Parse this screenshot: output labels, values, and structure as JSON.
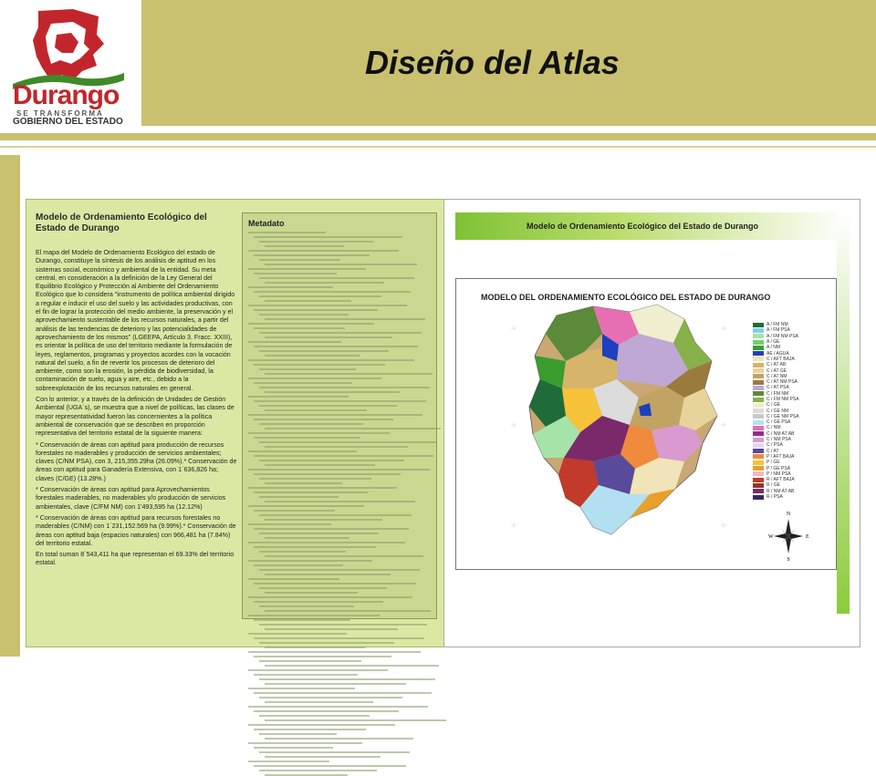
{
  "slide": {
    "title": "Diseño del Atlas"
  },
  "logo": {
    "name": "Durango",
    "tagline": "SE TRANSFORMA",
    "gov": "GOBIERNO DEL ESTADO"
  },
  "left_panel": {
    "heading": "Modelo de Ordenamiento Ecológico del Estado de Durango",
    "paragraphs": [
      "El mapa del Modelo de Ordenamiento Ecológico del estado de Durango, constituye la síntesis de los análisis de aptitud en los sistemas social, económico y ambiental de la entidad. Su meta central, en consideración a la definición de la Ley General del Equilibrio Ecológico y Protección al Ambiente del Ordenamiento Ecológico que lo considera \"instrumento de política ambiental dirigido a regular e inducir el uso del suelo y las actividades productivas, con el fin de lograr la protección del medio ambiente, la preservación y el aprovechamiento sustentable de los recursos naturales, a partir del análisis de las tendencias de deterioro y las potencialidades de aprovechamiento de los mismos\" (LGEEPA, Artículo 3. Fracc. XXIII), es orientar la política de uso del territorio mediante la formulación de leyes, reglamentos, programas y proyectos acordes con la vocación natural del suelo, a fin de revertir los procesos de deterioro del ambiente, como son la erosión, la pérdida de biodiversidad, la contaminación de suelo, agua y aire, etc., debido a la sobreexplotación de los recursos naturales en general.",
      "Con lo anterior, y a través de la definición de Unidades de Gestión Ambiental (UGA´s), se muestra que a nivel de políticas, las clases de mayor representatividad fueron las concernientes a la política ambiental de conservación que se describen en proporción representativa del territorio estatal de la siguiente manera:",
      "*        Conservación de áreas con aptitud para producción de recursos forestales no maderables y producción de servicios ambientales; claves (C/NM PSA), con 3, 215,355.29ha (26.09%).*      Conservación de áreas con aptitud para Ganadería Extensiva, con 1´636,826 ha; claves (C/GE) (13.28%.)",
      "*        Conservación de áreas con aptitud para Aprovechamientos forestales maderables, no maderables y/o producción de servicios ambientales, clave (C/FM NM) con 1'493,595 ha (12.12%)",
      "*        Conservación de áreas con aptitud para recursos forestales no maderables (C/NM) con 1´231,152.569 ha (9.99%).*      Conservación de áreas con aptitud baja (espacios naturales) con 966,481 ha (7.84%) del territorio estatal.",
      "En total suman 8´543,411 ha que representan el 69.33% del territorio estatal."
    ],
    "metadata_heading": "Metadato"
  },
  "right_panel": {
    "header": "Modelo de Ordenamiento Ecológico del Estado de Durango",
    "map_title": "MODELO DEL ORDENAMIENTO ECOLÓGICO DEL ESTADO DE DURANGO",
    "compass": {
      "n": "N",
      "s": "S",
      "e": "E",
      "w": "W"
    },
    "legend": [
      {
        "label": "A / FM NM",
        "color": "#1f6b3a"
      },
      {
        "label": "A / FM PSA",
        "color": "#7fd0e6"
      },
      {
        "label": "A / FM NM PSA",
        "color": "#a6e3a8"
      },
      {
        "label": "A / GE",
        "color": "#6fd06f"
      },
      {
        "label": "A / NM",
        "color": "#3a9c2e"
      },
      {
        "label": "AE / AGUA",
        "color": "#1e3fbf"
      },
      {
        "label": "C / AFT BAJA",
        "color": "#f0e4b8"
      },
      {
        "label": "C / AT AB",
        "color": "#d6b46a"
      },
      {
        "label": "C / AT GE",
        "color": "#e7d49a"
      },
      {
        "label": "C / AT NM",
        "color": "#c1a463"
      },
      {
        "label": "C / AT NM PSA",
        "color": "#9b7a3e"
      },
      {
        "label": "C / AT PSA",
        "color": "#bfa8d6"
      },
      {
        "label": "C / FM NM",
        "color": "#5a8a3a"
      },
      {
        "label": "C / FM NM PSA",
        "color": "#88b04b"
      },
      {
        "label": "C / GE",
        "color": "#f2efd0"
      },
      {
        "label": "C / GE NM",
        "color": "#dcdcdc"
      },
      {
        "label": "C / GE NM PSA",
        "color": "#c9c9c9"
      },
      {
        "label": "C / GE PSA",
        "color": "#b2e0f0"
      },
      {
        "label": "C / NM",
        "color": "#e66fb3"
      },
      {
        "label": "C / NM AT AB",
        "color": "#9a2a8a"
      },
      {
        "label": "C / NM PSA",
        "color": "#d99ad0"
      },
      {
        "label": "C / PSA",
        "color": "#e6d8ec"
      },
      {
        "label": "C / AT",
        "color": "#5a4a9a"
      },
      {
        "label": "P / AFT BAJA",
        "color": "#f08a3c"
      },
      {
        "label": "P / GE",
        "color": "#f6c23a"
      },
      {
        "label": "P / GE PSA",
        "color": "#e8a02a"
      },
      {
        "label": "P / NM PSA",
        "color": "#f2b6c4"
      },
      {
        "label": "R / AFT BAJA",
        "color": "#c23a2a"
      },
      {
        "label": "R / GE",
        "color": "#8a3a2a"
      },
      {
        "label": "R / NM AT AB",
        "color": "#7a2a6a"
      },
      {
        "label": "R / PSA",
        "color": "#3a2a5a"
      }
    ]
  },
  "colors": {
    "header_bar": "#c9c070",
    "left_panel_bg": "#dbe8a4",
    "logo_red": "#c2262c",
    "logo_green": "#3f8a2a"
  }
}
